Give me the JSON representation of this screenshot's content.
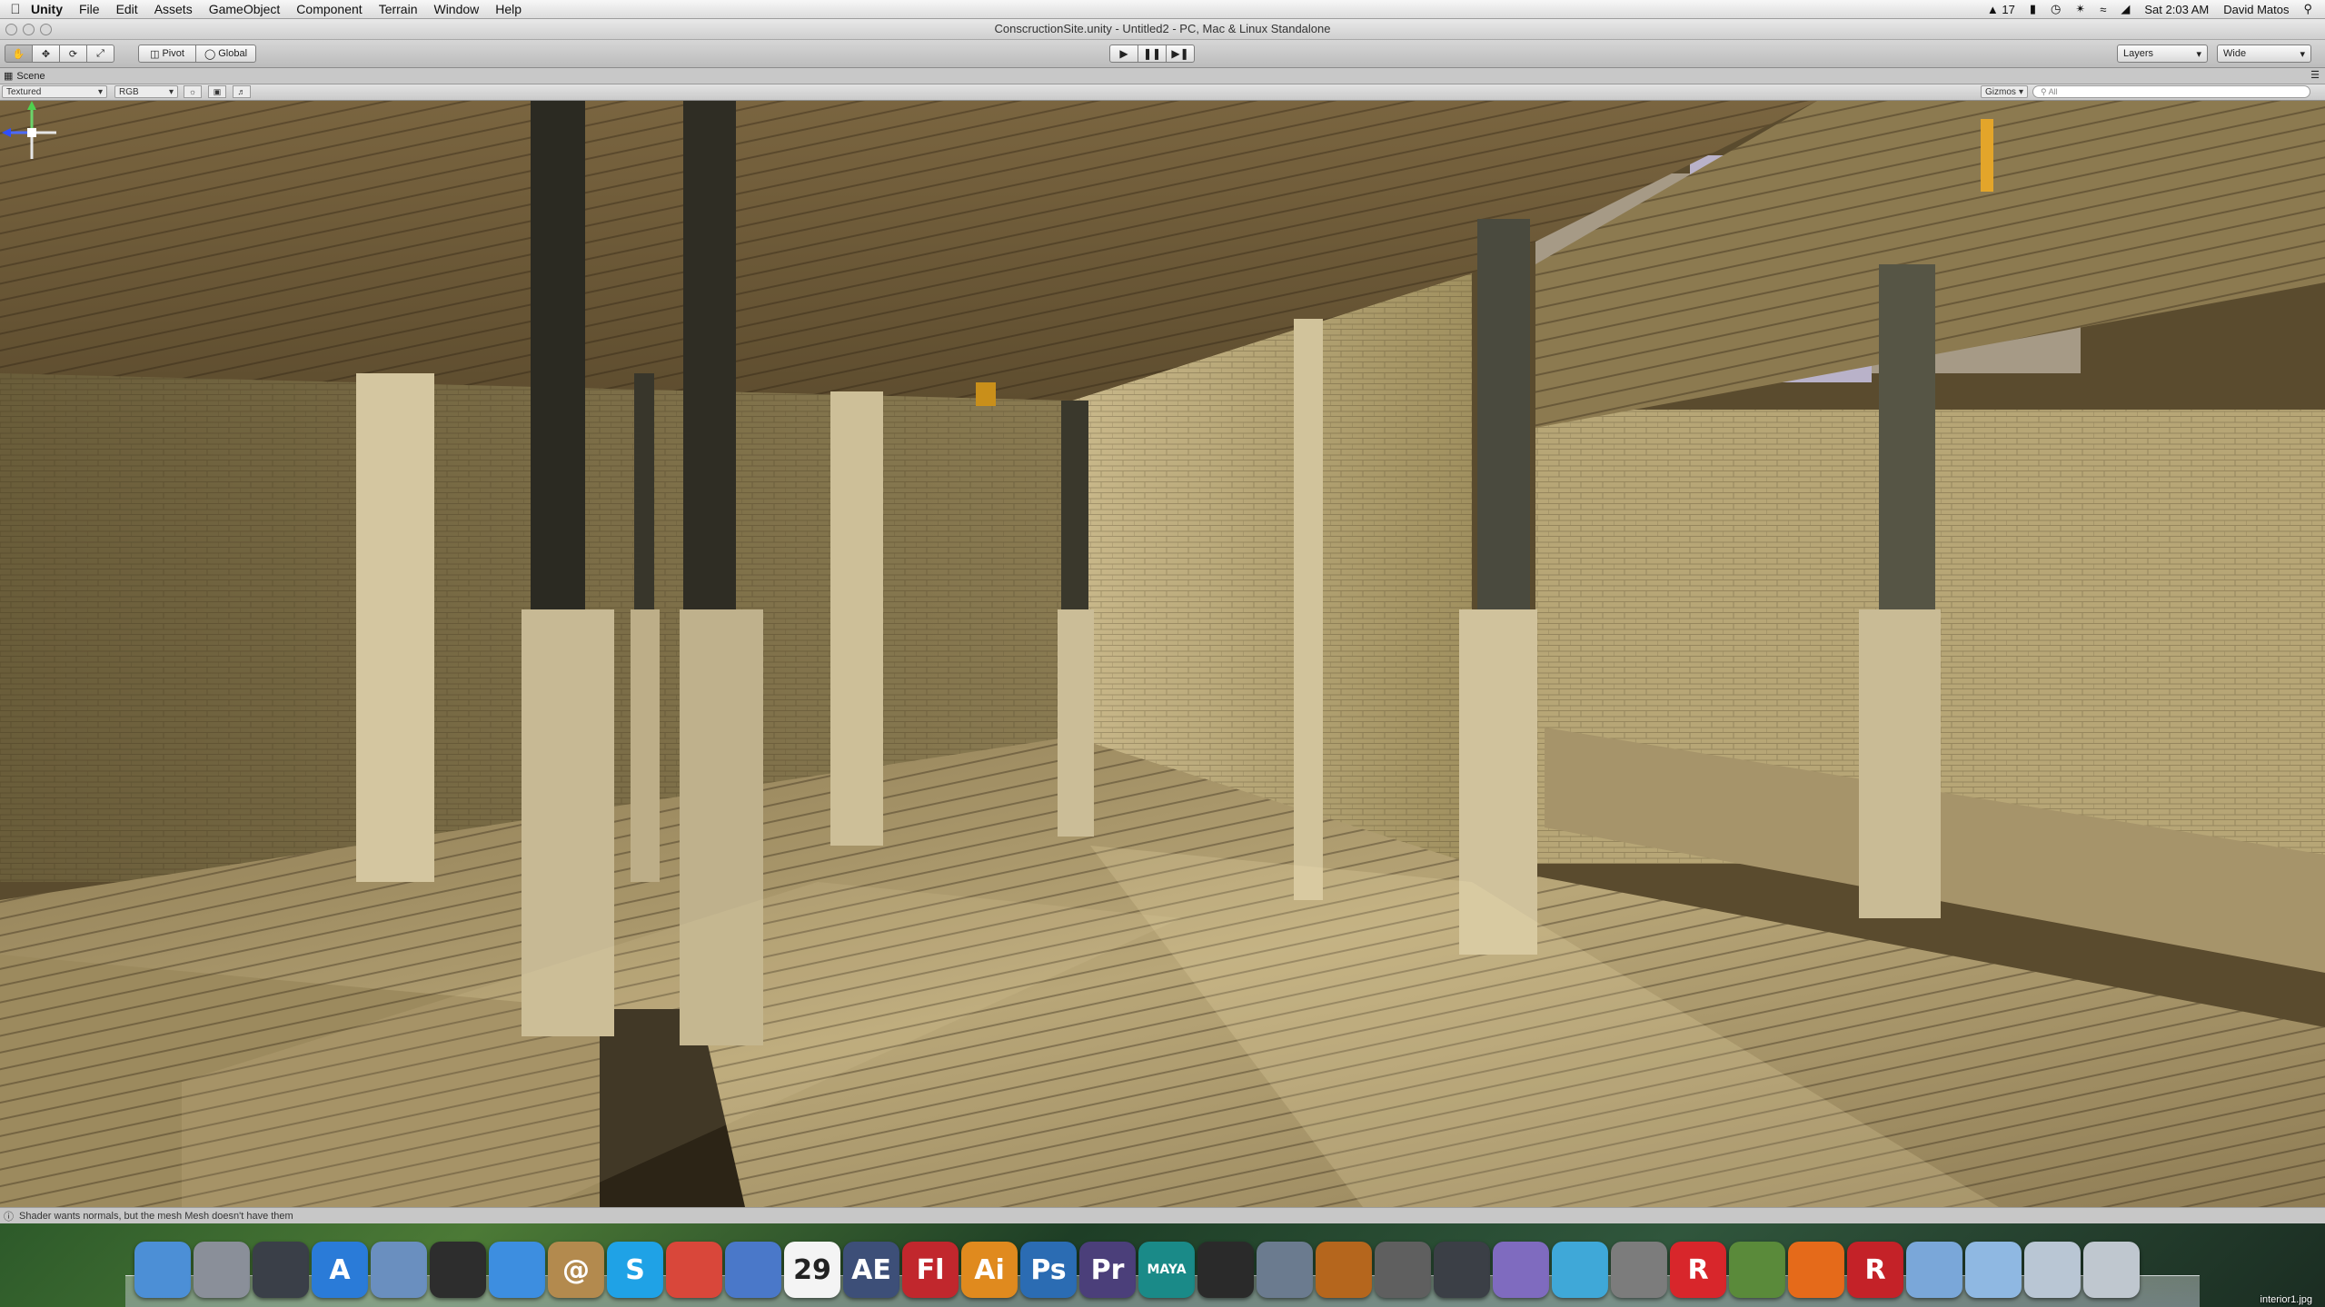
{
  "menubar": {
    "app_name": "Unity",
    "menus": [
      "File",
      "Edit",
      "Assets",
      "GameObject",
      "Component",
      "Terrain",
      "Window",
      "Help"
    ],
    "status": {
      "badge": "17",
      "time": "Sat 2:03 AM",
      "user": "David Matos"
    }
  },
  "window": {
    "title": "ConscructionSite.unity - Untitled2 - PC, Mac & Linux Standalone"
  },
  "toolbar": {
    "pivot_label": "Pivot",
    "global_label": "Global",
    "layers_label": "Layers",
    "layout_label": "Wide"
  },
  "scene": {
    "tab_label": "Scene",
    "render_mode": "Textured",
    "color_mode": "RGB",
    "gizmos_label": "Gizmos",
    "search_placeholder": "All"
  },
  "status_bar": {
    "message": "Shader wants normals, but the mesh Mesh doesn't have them"
  },
  "dock": {
    "items": [
      {
        "name": "finder-icon",
        "label": "",
        "color": "#4c8fd6"
      },
      {
        "name": "launchpad-icon",
        "label": "",
        "color": "#8a8f99"
      },
      {
        "name": "mission-control-icon",
        "label": "",
        "color": "#3a3f48"
      },
      {
        "name": "app-store-icon",
        "label": "A",
        "color": "#2a7bd8"
      },
      {
        "name": "mail-icon",
        "label": "",
        "color": "#6a8fbf"
      },
      {
        "name": "pencil-app-icon",
        "label": "",
        "color": "#2d2d2d"
      },
      {
        "name": "safari-icon",
        "label": "",
        "color": "#3d8ee0"
      },
      {
        "name": "contacts-icon",
        "label": "@",
        "color": "#b38a4e"
      },
      {
        "name": "skype-icon",
        "label": "S",
        "color": "#1fa2e6"
      },
      {
        "name": "chrome-icon",
        "label": "",
        "color": "#d9473a"
      },
      {
        "name": "itunes-icon",
        "label": "",
        "color": "#4a78c9"
      },
      {
        "name": "calendar-icon",
        "label": "29",
        "color": "#f4f4f4"
      },
      {
        "name": "after-effects-icon",
        "label": "AE",
        "color": "#3d4f78"
      },
      {
        "name": "flash-icon",
        "label": "Fl",
        "color": "#c1272d"
      },
      {
        "name": "illustrator-icon",
        "label": "Ai",
        "color": "#e08a1e"
      },
      {
        "name": "photoshop-icon",
        "label": "Ps",
        "color": "#2b6cb3"
      },
      {
        "name": "premiere-icon",
        "label": "Pr",
        "color": "#4b3f7a"
      },
      {
        "name": "maya-icon",
        "label": "MAYA",
        "color": "#1a8a88"
      },
      {
        "name": "unity-icon",
        "label": "",
        "color": "#2a2a2a"
      },
      {
        "name": "unity-remote-icon",
        "label": "",
        "color": "#6b7b8f"
      },
      {
        "name": "garageband-icon",
        "label": "",
        "color": "#b5661d"
      },
      {
        "name": "imovie-icon",
        "label": "",
        "color": "#5f5f5f"
      },
      {
        "name": "steam-icon",
        "label": "",
        "color": "#3b3f46"
      },
      {
        "name": "sphere-app-icon",
        "label": "",
        "color": "#7f6bbf"
      },
      {
        "name": "snowflake-app-icon",
        "label": "",
        "color": "#3fa8d8"
      },
      {
        "name": "system-preferences-icon",
        "label": "",
        "color": "#7c7c7c"
      },
      {
        "name": "roblox-icon",
        "label": "R",
        "color": "#d8262b"
      },
      {
        "name": "minecraft-icon",
        "label": "",
        "color": "#5a8a3a"
      },
      {
        "name": "firefox-icon",
        "label": "",
        "color": "#e56a1a"
      },
      {
        "name": "roblox-studio-icon",
        "label": "R",
        "color": "#c42228"
      },
      {
        "name": "applications-folder-icon",
        "label": "",
        "color": "#7aa7d9"
      },
      {
        "name": "documents-folder-icon",
        "label": "",
        "color": "#8fb8e2"
      },
      {
        "name": "unity-folder-icon",
        "label": "",
        "color": "#b9c6d4"
      },
      {
        "name": "trash-icon",
        "label": "",
        "color": "#bfc7cf"
      }
    ],
    "recent_file": "interior1.jpg"
  }
}
